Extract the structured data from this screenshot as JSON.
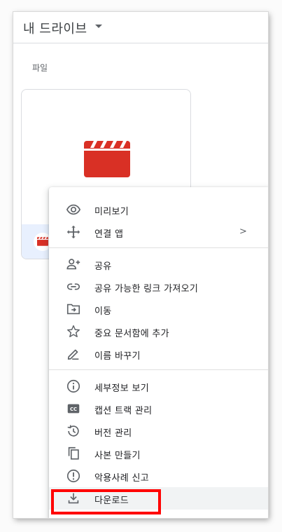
{
  "header": {
    "title": "내 드라이브"
  },
  "section": {
    "label": "파일"
  },
  "menu": {
    "items": [
      {
        "label": "미리보기",
        "icon": "eye-icon"
      },
      {
        "label": "연결 앱",
        "icon": "move-arrows-icon",
        "chevron": ">"
      },
      {
        "label": "공유",
        "icon": "person-add-icon"
      },
      {
        "label": "공유 가능한 링크 가져오기",
        "icon": "link-icon"
      },
      {
        "label": "이동",
        "icon": "folder-move-icon"
      },
      {
        "label": "중요 문서함에 추가",
        "icon": "star-icon"
      },
      {
        "label": "이름 바꾸기",
        "icon": "pencil-icon"
      },
      {
        "label": "세부정보 보기",
        "icon": "info-icon"
      },
      {
        "label": "캡션 트랙 관리",
        "icon": "cc-icon"
      },
      {
        "label": "버전 관리",
        "icon": "history-icon"
      },
      {
        "label": "사본 만들기",
        "icon": "copy-icon"
      },
      {
        "label": "악용사례 신고",
        "icon": "report-icon"
      },
      {
        "label": "다운로드",
        "icon": "download-icon"
      }
    ]
  },
  "colors": {
    "video": "#d93025",
    "highlight": "#ff0000",
    "icon": "#5f6368"
  }
}
